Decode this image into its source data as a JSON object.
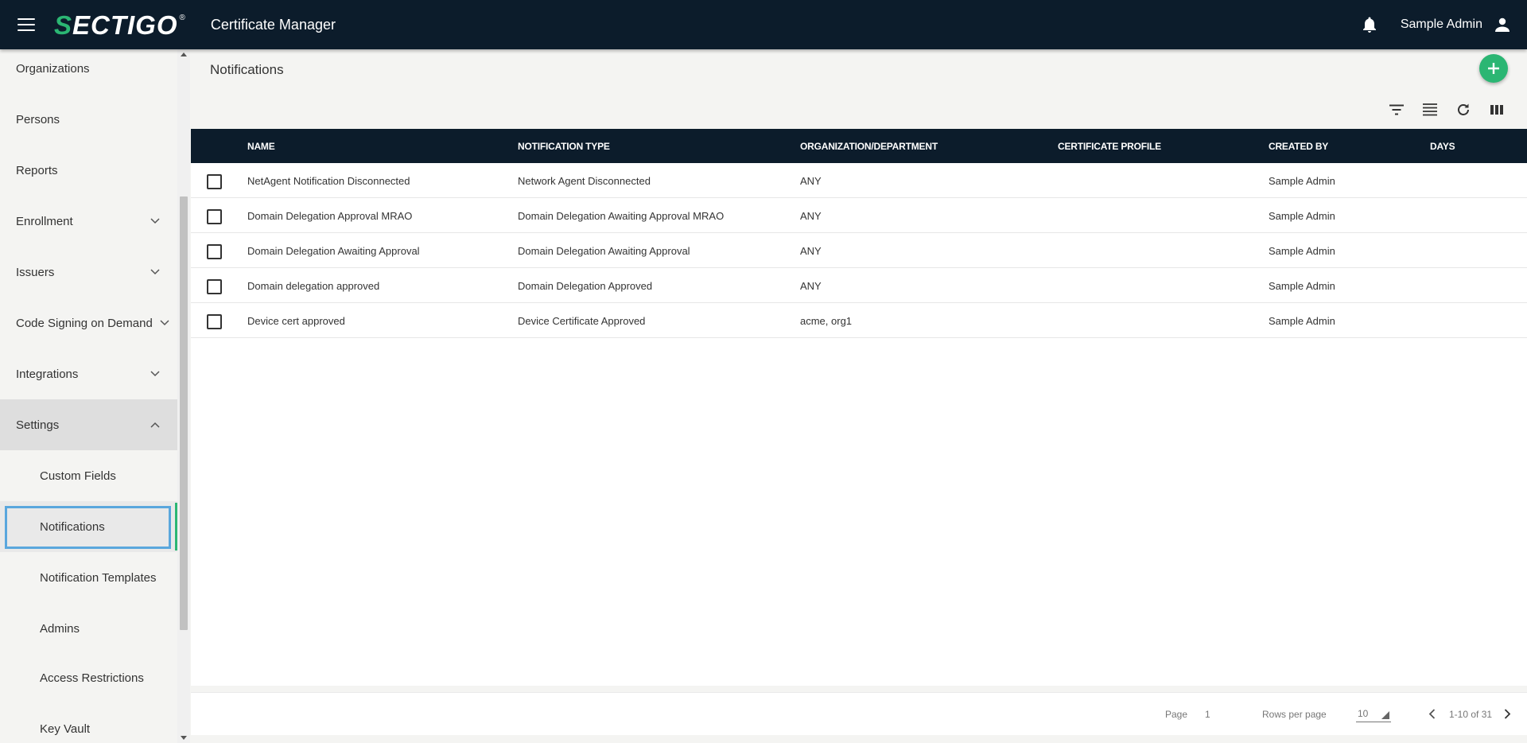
{
  "header": {
    "logo_prefix": "S",
    "logo_rest": "ECTIGO",
    "logo_reg": "®",
    "app_title": "Certificate Manager",
    "user_name": "Sample Admin"
  },
  "sidebar": {
    "items": [
      {
        "label": "Organizations"
      },
      {
        "label": "Persons"
      },
      {
        "label": "Reports"
      },
      {
        "label": "Enrollment"
      },
      {
        "label": "Issuers"
      },
      {
        "label": "Code Signing on Demand"
      },
      {
        "label": "Integrations"
      },
      {
        "label": "Settings"
      },
      {
        "label": "Custom Fields"
      },
      {
        "label": "Notifications"
      },
      {
        "label": "Notification Templates"
      },
      {
        "label": "Admins"
      },
      {
        "label": "Access Restrictions"
      },
      {
        "label": "Key Vault"
      }
    ]
  },
  "main": {
    "title": "Notifications",
    "columns": {
      "name": "NAME",
      "type": "NOTIFICATION TYPE",
      "org": "ORGANIZATION/DEPARTMENT",
      "profile": "CERTIFICATE PROFILE",
      "created": "CREATED BY",
      "days": "DAYS"
    },
    "rows": [
      {
        "name": "NetAgent Notification Disconnected",
        "type": "Network Agent Disconnected",
        "org": "ANY",
        "profile": "",
        "created": "Sample Admin",
        "days": ""
      },
      {
        "name": "Domain Delegation Approval MRAO",
        "type": "Domain Delegation Awaiting Approval MRAO",
        "org": "ANY",
        "profile": "",
        "created": "Sample Admin",
        "days": ""
      },
      {
        "name": "Domain Delegation Awaiting Approval",
        "type": "Domain Delegation Awaiting Approval",
        "org": "ANY",
        "profile": "",
        "created": "Sample Admin",
        "days": ""
      },
      {
        "name": "Domain delegation approved",
        "type": "Domain Delegation Approved",
        "org": "ANY",
        "profile": "",
        "created": "Sample Admin",
        "days": ""
      },
      {
        "name": "Device cert approved",
        "type": "Device Certificate Approved",
        "org": "acme, org1",
        "profile": "",
        "created": "Sample Admin",
        "days": ""
      }
    ]
  },
  "footer": {
    "page_label": "Page",
    "page_number": "1",
    "rows_label": "Rows per page",
    "rows_value": "10",
    "range": "1-10 of 31"
  },
  "colors": {
    "header_bg": "#0c1c2b",
    "accent_green": "#2bb673",
    "selection_outline": "#5aa7dd"
  }
}
